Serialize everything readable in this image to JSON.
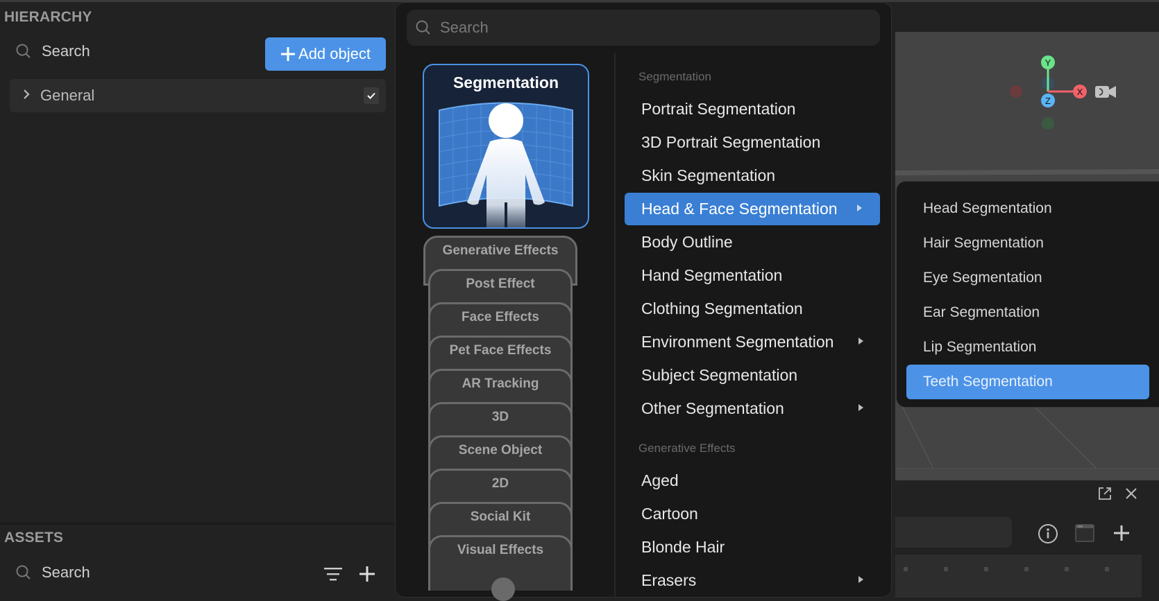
{
  "hierarchy": {
    "title": "HIERARCHY",
    "search_placeholder": "Search",
    "add_object_label": "Add object",
    "tree": [
      {
        "label": "General",
        "checked": true
      }
    ]
  },
  "assets": {
    "title": "ASSETS",
    "search_placeholder": "Search"
  },
  "popup": {
    "search_placeholder": "Search",
    "selected_category": "Segmentation",
    "categories": [
      "Generative Effects",
      "Post Effect",
      "Face Effects",
      "Pet Face Effects",
      "AR Tracking",
      "3D",
      "Scene Object",
      "2D",
      "Social Kit",
      "Visual Effects"
    ],
    "menu": {
      "sections": [
        {
          "header": "Segmentation",
          "items": [
            {
              "label": "Portrait Segmentation",
              "submenu": false
            },
            {
              "label": "3D Portrait Segmentation",
              "submenu": false
            },
            {
              "label": "Skin Segmentation",
              "submenu": false
            },
            {
              "label": "Head & Face Segmentation",
              "submenu": true,
              "active": true
            },
            {
              "label": "Body Outline",
              "submenu": false
            },
            {
              "label": "Hand Segmentation",
              "submenu": false
            },
            {
              "label": "Clothing Segmentation",
              "submenu": false
            },
            {
              "label": "Environment Segmentation",
              "submenu": true
            },
            {
              "label": "Subject Segmentation",
              "submenu": false
            },
            {
              "label": "Other Segmentation",
              "submenu": true
            }
          ]
        },
        {
          "header": "Generative Effects",
          "items": [
            {
              "label": "Aged",
              "submenu": false
            },
            {
              "label": "Cartoon",
              "submenu": false
            },
            {
              "label": "Blonde Hair",
              "submenu": false
            },
            {
              "label": "Erasers",
              "submenu": true
            }
          ]
        }
      ]
    }
  },
  "submenu": {
    "items": [
      {
        "label": "Head Segmentation"
      },
      {
        "label": "Hair Segmentation"
      },
      {
        "label": "Eye Segmentation"
      },
      {
        "label": "Ear Segmentation"
      },
      {
        "label": "Lip Segmentation"
      },
      {
        "label": "Teeth Segmentation",
        "active": true
      }
    ]
  },
  "viewport": {
    "gizmo": {
      "x_label": "X",
      "y_label": "Y",
      "z_label": "Z"
    },
    "colors": {
      "x": "#f0626a",
      "y": "#6be38a",
      "z": "#5ab4f5"
    }
  },
  "colors": {
    "accent": "#4c93e8",
    "active_menu": "#3a7fd4"
  }
}
